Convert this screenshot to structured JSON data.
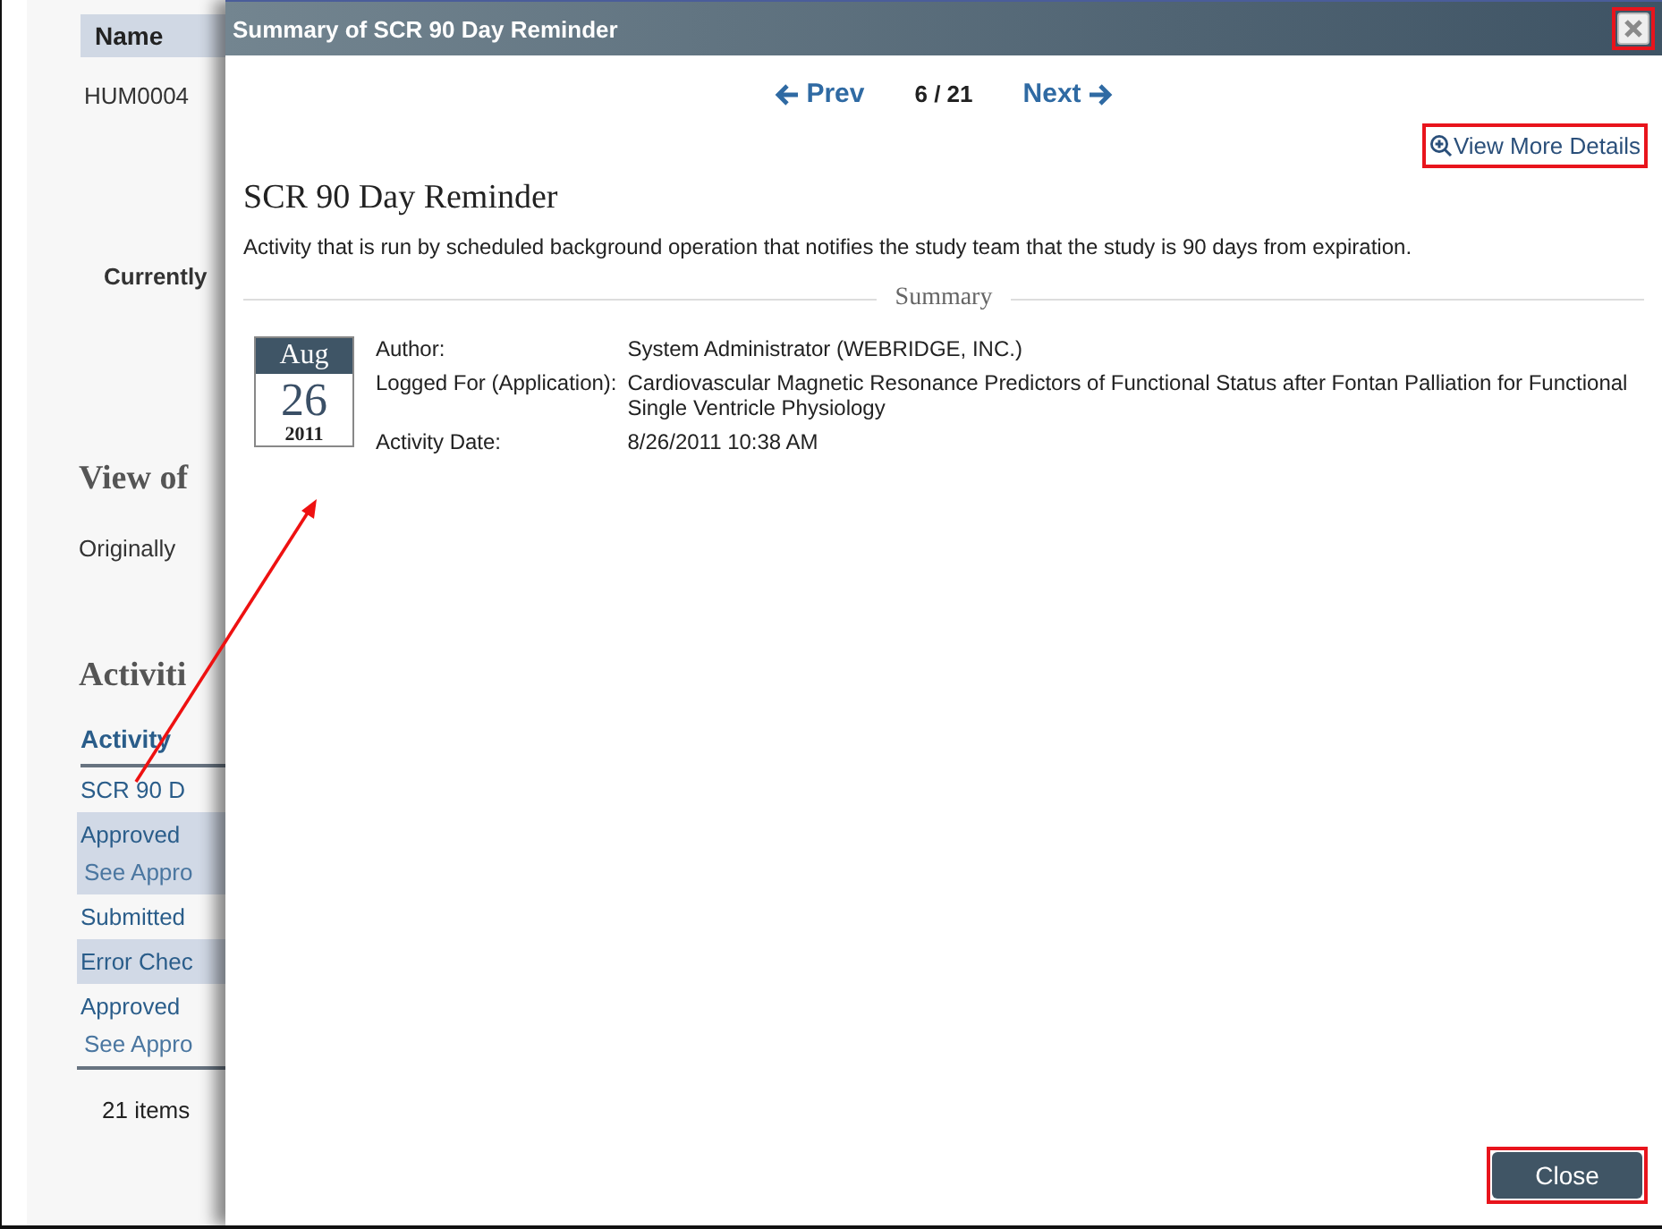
{
  "background_page": {
    "table_header": "Name",
    "record_id": "HUM0004",
    "current_label": "Currently",
    "view_heading": "View of",
    "originally_label": "Originally",
    "activities_heading": "Activiti",
    "activity_column": "Activity",
    "activity_rows": [
      {
        "lines": [
          "SCR 90 D"
        ],
        "shaded": false
      },
      {
        "lines": [
          "Approved",
          "See Appro"
        ],
        "shaded": true
      },
      {
        "lines": [
          "Submitted"
        ],
        "shaded": false
      },
      {
        "lines": [
          "Error Chec"
        ],
        "shaded": true
      },
      {
        "lines": [
          "Approved",
          "See Appro"
        ],
        "shaded": false
      }
    ],
    "item_count": "21 items"
  },
  "dialog": {
    "title": "Summary of SCR 90 Day Reminder",
    "close_icon_highlighted": true,
    "pager": {
      "prev": "Prev",
      "position": "6 / 21",
      "next": "Next"
    },
    "details_link": {
      "label": "View More Details",
      "highlighted": true
    },
    "heading": "SCR 90 Day Reminder",
    "description": "Activity that is run by scheduled background operation that notifies the study team that the study is 90 days from expiration.",
    "section_title": "Summary",
    "calendar": {
      "month": "Aug",
      "day": "26",
      "year": "2011"
    },
    "fields": [
      {
        "label": "Author:",
        "value": "System Administrator (WEBRIDGE, INC.)"
      },
      {
        "label": "Logged For (Application):",
        "value": "Cardiovascular Magnetic Resonance Predictors of Functional Status after Fontan Palliation for Functional Single Ventricle Physiology"
      },
      {
        "label": "Activity Date:",
        "value": "8/26/2011 10:38 AM"
      }
    ],
    "close_button": {
      "label": "Close",
      "highlighted": true
    }
  },
  "callout_arrow": true
}
